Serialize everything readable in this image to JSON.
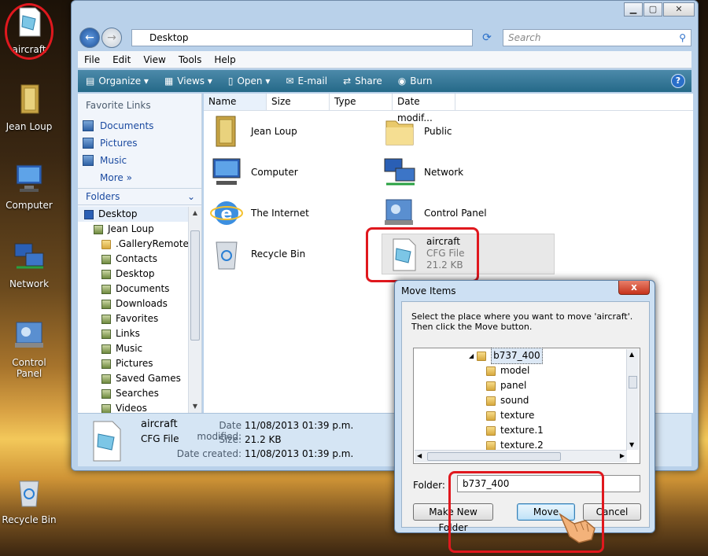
{
  "desktop": {
    "icons": [
      {
        "label": "aircraft",
        "icon": "cfg-file-icon"
      },
      {
        "label": "Jean Loup",
        "icon": "user-folder-icon"
      },
      {
        "label": "Computer",
        "icon": "computer-icon"
      },
      {
        "label": "Network",
        "icon": "network-icon"
      },
      {
        "label": "Control Panel",
        "icon": "control-panel-icon"
      },
      {
        "label": "Recycle Bin",
        "icon": "recycle-bin-icon"
      }
    ]
  },
  "explorer": {
    "address": "Desktop",
    "search_placeholder": "Search",
    "menu": [
      "File",
      "Edit",
      "View",
      "Tools",
      "Help"
    ],
    "toolbar": [
      "Organize",
      "Views",
      "Open",
      "E-mail",
      "Share",
      "Burn"
    ],
    "help": "?",
    "favorite_links_title": "Favorite Links",
    "favorite_links": [
      "Documents",
      "Pictures",
      "Music",
      "More"
    ],
    "folders_title": "Folders",
    "tree": [
      "Desktop",
      "Jean Loup",
      ".GalleryRemote",
      "Contacts",
      "Desktop",
      "Documents",
      "Downloads",
      "Favorites",
      "Links",
      "Music",
      "Pictures",
      "Saved Games",
      "Searches",
      "Videos"
    ],
    "columns": [
      "Name",
      "Size",
      "Type",
      "Date modif..."
    ],
    "items": [
      {
        "name": "Jean Loup",
        "icon": "user-folder-icon"
      },
      {
        "name": "Public",
        "icon": "folder-icon"
      },
      {
        "name": "Computer",
        "icon": "computer-icon"
      },
      {
        "name": "Network",
        "icon": "network-icon"
      },
      {
        "name": "The Internet",
        "icon": "internet-explorer-icon"
      },
      {
        "name": "Control Panel",
        "icon": "control-panel-icon"
      },
      {
        "name": "Recycle Bin",
        "icon": "recycle-bin-icon"
      }
    ],
    "selected": {
      "name": "aircraft",
      "type": "CFG File",
      "size": "21.2 KB"
    },
    "details": {
      "name": "aircraft",
      "type": "CFG File",
      "modified_label": "Date modified:",
      "modified": "11/08/2013 01:39 p.m.",
      "size_label": "Size:",
      "size": "21.2 KB",
      "created_label": "Date created:",
      "created": "11/08/2013 01:39 p.m."
    }
  },
  "dialog": {
    "title": "Move Items",
    "close": "x",
    "prompt": "Select the place where you want to move 'aircraft'. Then click the Move button.",
    "tree": [
      "b737_400",
      "model",
      "panel",
      "sound",
      "texture",
      "texture.1",
      "texture.2"
    ],
    "folder_label": "Folder:",
    "folder_value": "b737_400",
    "make_new_folder": "Make New Folder",
    "move": "Move",
    "cancel": "Cancel"
  },
  "colors": {
    "highlight": "#e0181e",
    "toolbar": "#256988"
  }
}
